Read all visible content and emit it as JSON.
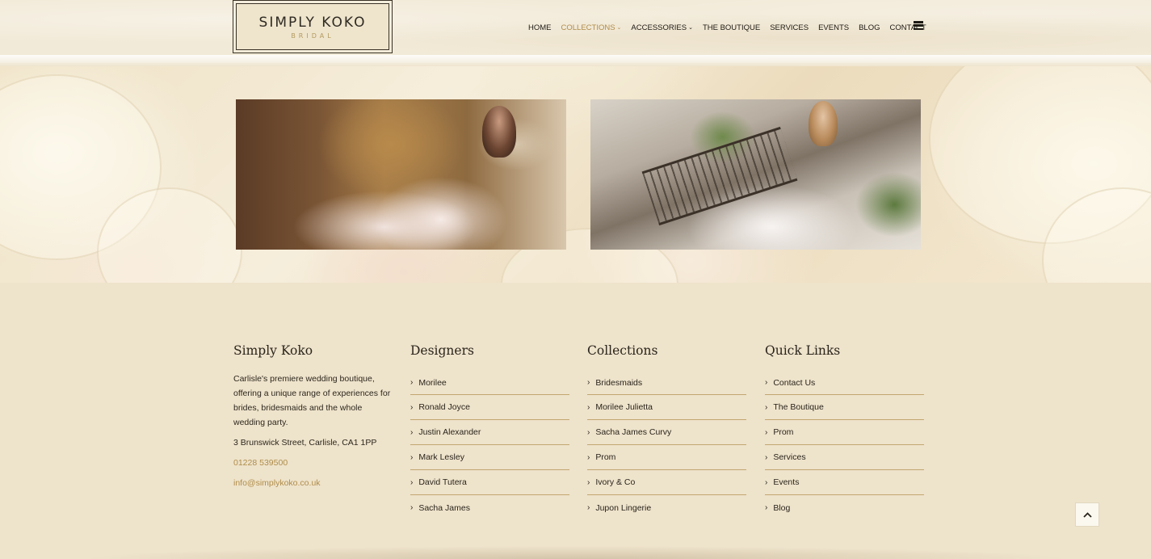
{
  "logo": {
    "main": "SIMPLY KOKO",
    "sub": "BRIDAL"
  },
  "nav": {
    "items": [
      {
        "label": "HOME",
        "active": false,
        "dropdown": false
      },
      {
        "label": "COLLECTIONS",
        "active": true,
        "dropdown": true
      },
      {
        "label": "ACCESSORIES",
        "active": false,
        "dropdown": true
      },
      {
        "label": "THE BOUTIQUE",
        "active": false,
        "dropdown": false
      },
      {
        "label": "SERVICES",
        "active": false,
        "dropdown": false
      },
      {
        "label": "EVENTS",
        "active": false,
        "dropdown": false
      },
      {
        "label": "BLOG",
        "active": false,
        "dropdown": false
      },
      {
        "label": "CONTACT",
        "active": false,
        "dropdown": false
      }
    ],
    "menu_icon": "hamburger-icon"
  },
  "footer": {
    "about": {
      "title": "Simply Koko",
      "text": "Carlisle's premiere wedding boutique, offering a unique range of experiences for brides, bridesmaids and the whole wedding party.",
      "address": "3 Brunswick Street, Carlisle, CA1 1PP",
      "phone": "01228 539500",
      "email": "info@simplykoko.co.uk"
    },
    "designers": {
      "title": "Designers",
      "items": [
        "Morilee",
        "Ronald Joyce",
        "Justin Alexander",
        "Mark Lesley",
        "David Tutera",
        "Sacha James"
      ]
    },
    "collections": {
      "title": "Collections",
      "items": [
        "Bridesmaids",
        "Morilee Julietta",
        "Sacha James Curvy",
        "Prom",
        "Ivory & Co",
        "Jupon Lingerie"
      ]
    },
    "quick_links": {
      "title": "Quick Links",
      "items": [
        "Contact Us",
        "The Boutique",
        "Prom",
        "Services",
        "Events",
        "Blog"
      ]
    }
  },
  "icons": {
    "back_to_top": "chevron-up-icon",
    "list_marker": "chevron-right-icon"
  },
  "colors": {
    "accent": "#b08d4a",
    "background": "#eee3cb",
    "divider": "#c2a670"
  }
}
